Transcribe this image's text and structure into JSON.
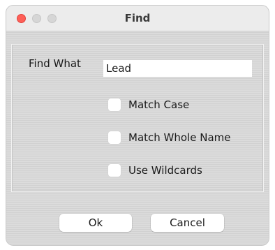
{
  "window": {
    "title": "Find"
  },
  "form": {
    "find_what_label": "Find What",
    "find_what_value": "Lead",
    "options": [
      {
        "label": "Match Case",
        "checked": false
      },
      {
        "label": "Match Whole Name",
        "checked": false
      },
      {
        "label": "Use Wildcards",
        "checked": false
      }
    ]
  },
  "buttons": {
    "ok_label": "Ok",
    "cancel_label": "Cancel"
  },
  "colors": {
    "close_button": "#fe5f57",
    "inactive_button": "#d6d6d6",
    "dialog_background": "#d8d8d8"
  }
}
